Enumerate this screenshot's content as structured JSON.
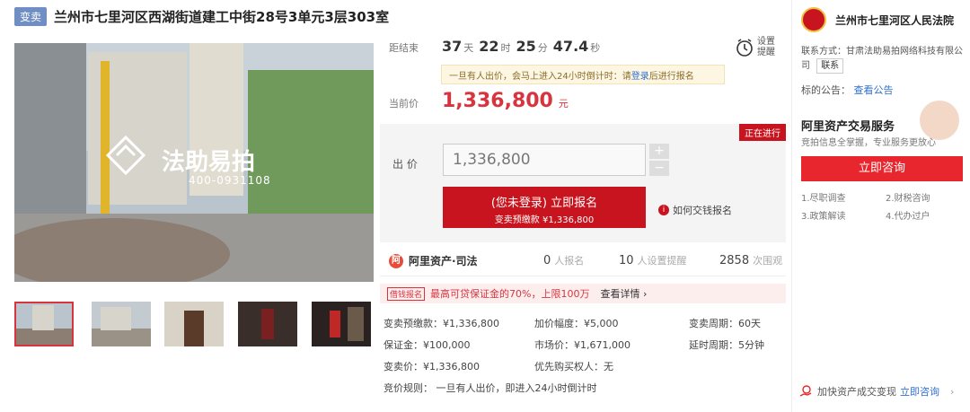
{
  "header": {
    "tag": "变卖",
    "title": "兰州市七里河区西湖街道建工中街28号3单元3层303室"
  },
  "gallery": {
    "watermark_brand": "法助易拍",
    "watermark_phone": "400-0931108"
  },
  "countdown": {
    "label": "距结束",
    "days": "37",
    "days_unit": "天",
    "hours": "22",
    "hours_unit": "时",
    "minutes": "25",
    "minutes_unit": "分",
    "seconds": "47.4",
    "seconds_unit": "秒"
  },
  "remind": {
    "label_line1": "设置",
    "label_line2": "提醒"
  },
  "notice": {
    "text_pre": "一旦有人出价，会马上进入24小时倒计时：请",
    "login_link": "登录",
    "text_post": "后进行报名"
  },
  "current_price": {
    "label": "当前价",
    "value": "1,336,800",
    "unit": "元"
  },
  "status_tag": "正在进行",
  "bid": {
    "label": "出 价",
    "input_value": "1,336,800",
    "plus": "+",
    "minus": "−",
    "signup_main": "(您未登录) 立即报名",
    "signup_sub": "变卖预缴款 ¥1,336,800",
    "how_label": "如何交钱报名"
  },
  "brand": {
    "name": "阿里资产·司法",
    "signup_count": "0",
    "signup_label": "人报名",
    "remind_count": "10",
    "remind_label": "人设置提醒",
    "view_count": "2858",
    "view_label": "次围观"
  },
  "promo": {
    "tag": "借钱报名",
    "text": "最高可贷保证金的70%，上限100万",
    "link": "查看详情 ›"
  },
  "details": {
    "deposit": "变卖预缴款：¥1,336,800",
    "increment": "加价幅度：¥5,000",
    "period": "变卖周期：60天",
    "guarantee": "保证金：¥100,000",
    "market_price": "市场价：¥1,671,000",
    "delay": "延时周期：5分钟",
    "sale_price": "变卖价：¥1,336,800",
    "priority": "优先购买权人",
    "priority_value": "：无",
    "rules": "竞价规则：  一旦有人出价，即进入24小时倒计时"
  },
  "sidebar": {
    "court_name": "兰州市七里河区人民法院",
    "contact_prefix": "联系方式：甘肃法助易拍网络科技有限公司",
    "contact_button": "联系",
    "notice_label": "标的公告：",
    "notice_link": "查看公告",
    "ad_title": "阿里资产交易服务",
    "ad_sub": "竞拍信息全掌握，专业服务更放心",
    "consult_button": "立即咨询",
    "services": [
      "1.尽职调查",
      "2.财税咨询",
      "3.政策解读",
      "4.代办过户"
    ],
    "footer_text": "加快资产成交变现",
    "footer_link": "立即咨询",
    "footer_arrow": "›"
  },
  "colors": {
    "accent": "#c8141e",
    "link": "#2f6fd0",
    "tag_blue": "#6f8fc4"
  }
}
